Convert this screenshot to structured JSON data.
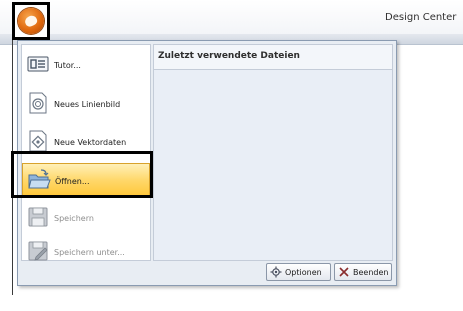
{
  "window": {
    "title": "Design Center"
  },
  "app_button": {
    "icon": "app-orb-icon"
  },
  "menu": {
    "items": [
      {
        "label": "Tutor...",
        "icon": "tutor-icon",
        "enabled": true
      },
      {
        "label": "Neues Linienbild",
        "icon": "new-line-image-icon",
        "enabled": true
      },
      {
        "label": "Neue Vektordaten",
        "icon": "new-vector-data-icon",
        "enabled": true
      },
      {
        "label": "Öffnen...",
        "icon": "folder-open-icon",
        "enabled": true,
        "highlighted": true
      },
      {
        "label": "Speichern",
        "icon": "save-icon",
        "enabled": false
      },
      {
        "label": "Speichern unter...",
        "icon": "save-as-icon",
        "enabled": false
      }
    ],
    "recent": {
      "title": "Zuletzt verwendete Dateien",
      "files": []
    },
    "footer": {
      "options_label": "Optionen",
      "exit_label": "Beenden"
    }
  },
  "colors": {
    "highlight": "#ffd86b",
    "orb": "#e06a10",
    "frame": "#000000"
  }
}
